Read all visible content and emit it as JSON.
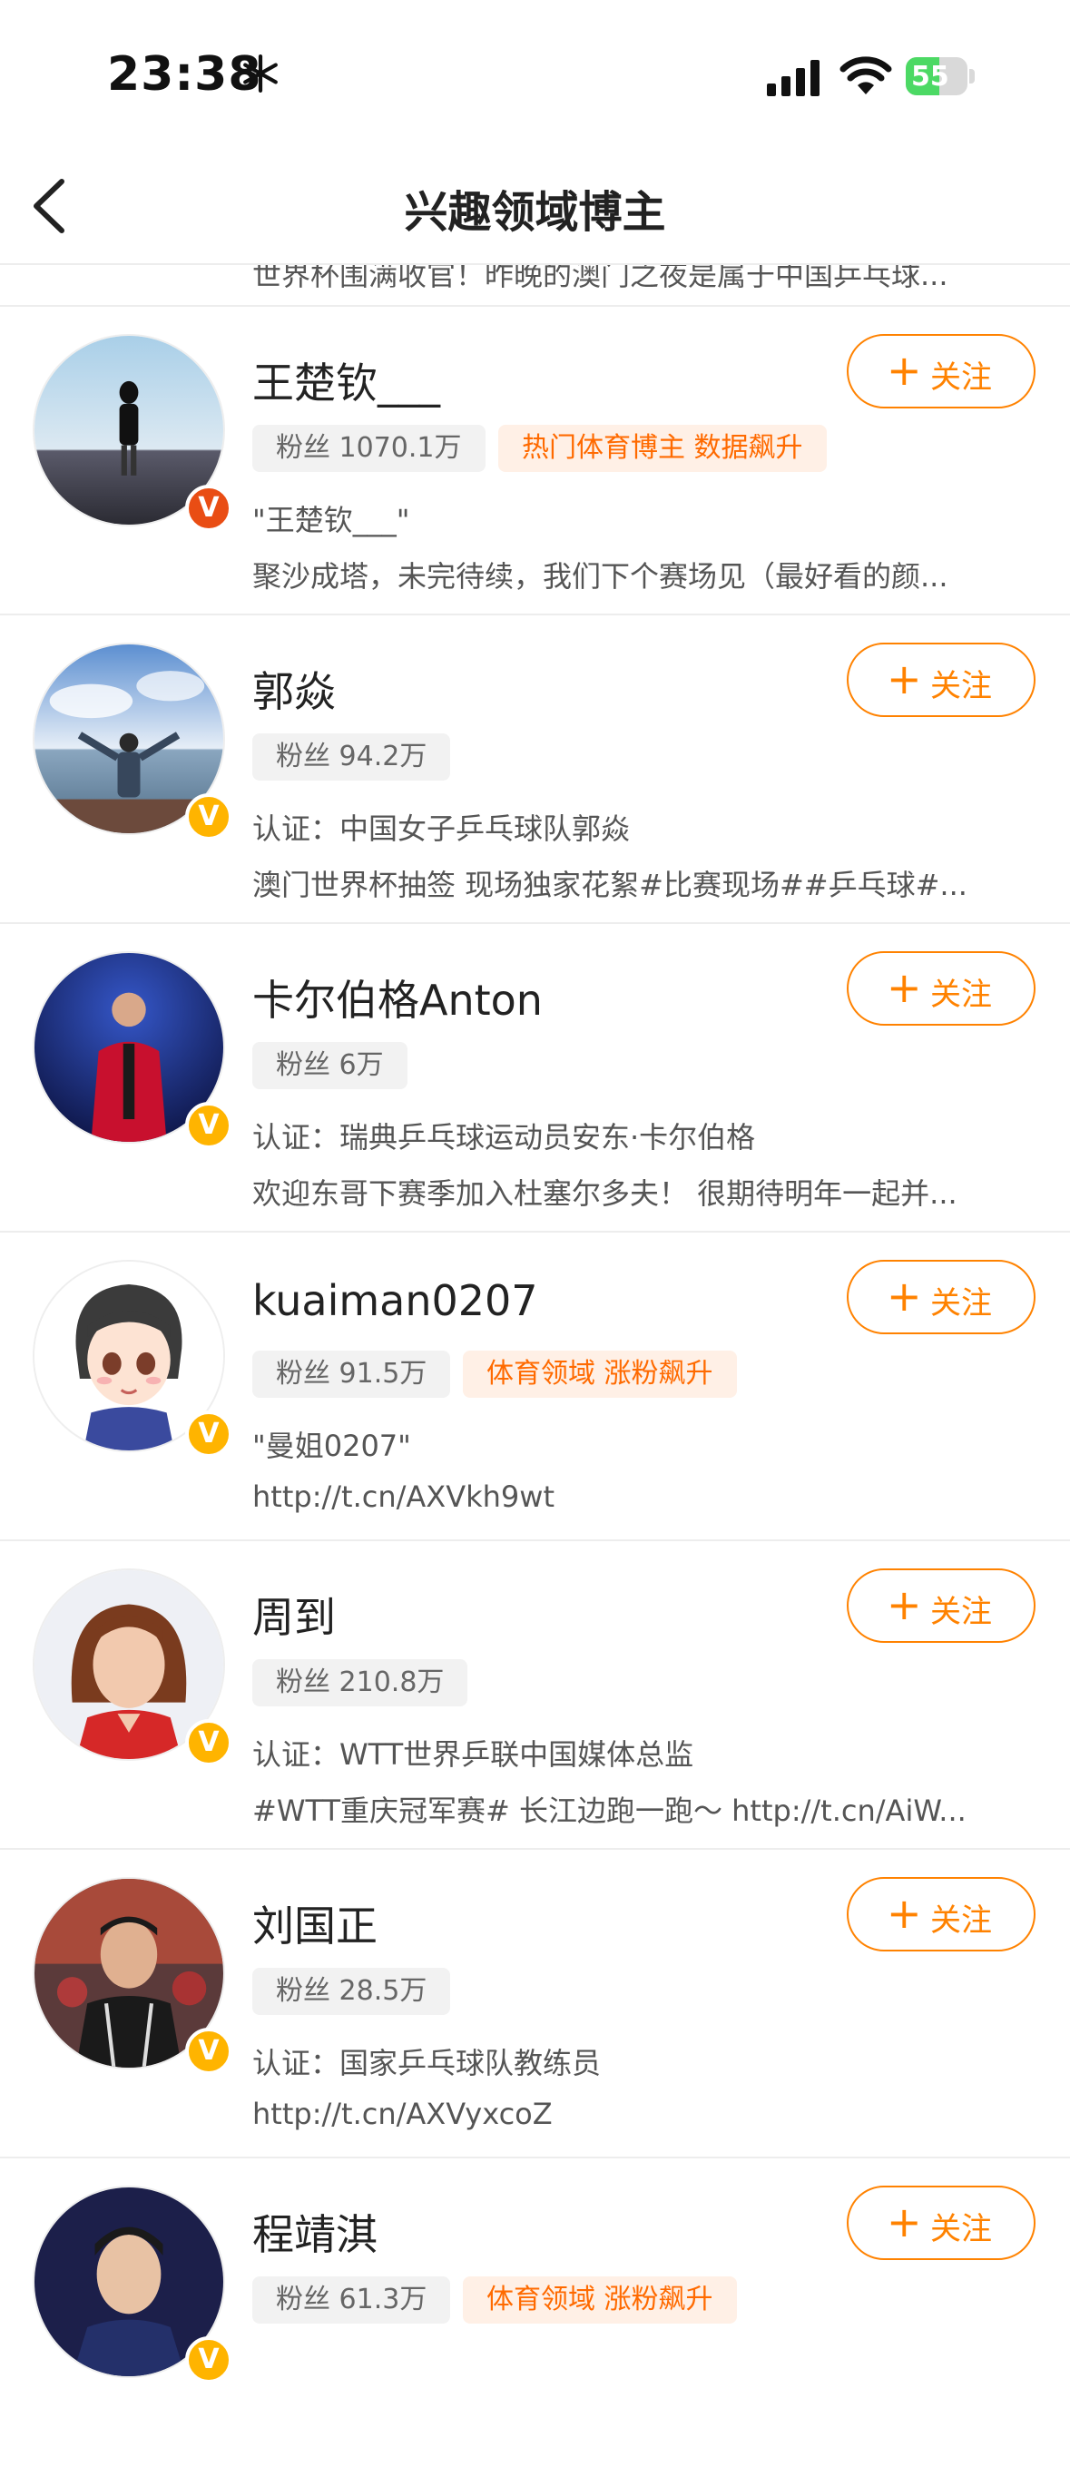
{
  "status_bar": {
    "time": "23:38",
    "battery": "55",
    "battery_level": 0.55
  },
  "nav": {
    "title": "兴趣领域博主"
  },
  "partial_row": {
    "text": "世界杯围满收官！昨晚的澳门之夜是属于中国乒乓球..."
  },
  "follow_label": "关注",
  "follow_plus": "+",
  "verified_glyph": "V",
  "bloggers": [
    {
      "name": "王楚钦___",
      "fans": "粉丝 1070.1万",
      "tag": "热门体育博主 数据飙升",
      "line3": "\"王楚钦___\"",
      "line4": "聚沙成塔，未完待续，我们下个赛场见（最好看的颜...",
      "badge": "red",
      "avatar": "man-on-rocks"
    },
    {
      "name": "郭焱",
      "fans": "粉丝 94.2万",
      "tag": "",
      "line3": "认证：中国女子乒乓球队郭焱",
      "line4": "澳门世界杯抽签 现场独家花絮#比赛现场##乒乓球#...",
      "badge": "orange",
      "avatar": "arms-out-by-sea"
    },
    {
      "name": "卡尔伯格Anton",
      "fans": "粉丝 6万",
      "tag": "",
      "line3": "认证：瑞典乒乓球运动员安东·卡尔伯格",
      "line4": "欢迎东哥下赛季加入杜塞尔多夫！ 很期待明年一起并...",
      "badge": "orange",
      "avatar": "player-red-jacket"
    },
    {
      "name": "kuaiman0207",
      "fans": "粉丝 91.5万",
      "tag": "体育领域 涨粉飙升",
      "line3": "\"曼姐0207\"",
      "line4": "http://t.cn/AXVkh9wt",
      "badge": "orange",
      "avatar": "cartoon-girl"
    },
    {
      "name": "周到",
      "fans": "粉丝 210.8万",
      "tag": "",
      "line3": "认证：WTT世界乒联中国媒体总监",
      "line4": "#WTT重庆冠军赛# 长江边跑一跑～ http://t.cn/AiW...",
      "badge": "orange",
      "avatar": "woman-portrait"
    },
    {
      "name": "刘国正",
      "fans": "粉丝 28.5万",
      "tag": "",
      "line3": "认证：国家乒乓球队教练员",
      "line4": "http://t.cn/AXVyxcoZ",
      "badge": "orange",
      "avatar": "coach-portrait"
    },
    {
      "name": "程靖淇",
      "fans": "粉丝 61.3万",
      "tag": "体育领域 涨粉飙升",
      "line3": "",
      "line4": "",
      "badge": "orange",
      "avatar": "young-man-portrait"
    }
  ],
  "colors": {
    "accent": "#ff8200",
    "tag_text": "#ff6a00",
    "tag_bg": "#fff0e6",
    "badge_orange": "#ffb400",
    "badge_red": "#e94d14"
  }
}
